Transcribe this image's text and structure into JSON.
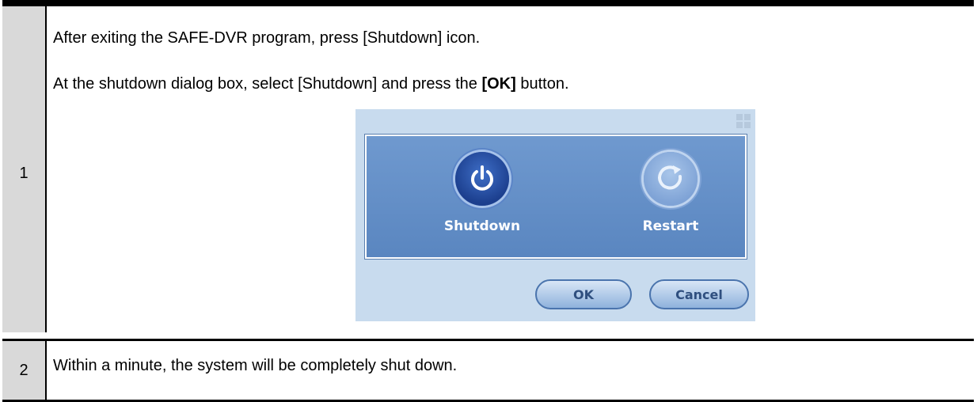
{
  "steps": [
    {
      "number": "1",
      "line1": "After exiting the SAFE-DVR program, press [Shutdown] icon.",
      "line2_prefix": "At the shutdown dialog box, select [Shutdown] and press the ",
      "line2_bold": "[OK]",
      "line2_suffix": " button."
    },
    {
      "number": "2",
      "line1": "Within a minute, the system will be completely shut down."
    }
  ],
  "dialog": {
    "shutdown_label": "Shutdown",
    "restart_label": "Restart",
    "ok_label": "OK",
    "cancel_label": "Cancel",
    "icons": {
      "shutdown": "power-icon",
      "restart": "restart-icon"
    },
    "colors": {
      "panel": "#5a86c0",
      "background": "#c8dbee",
      "button_border": "#4a74ad"
    }
  }
}
